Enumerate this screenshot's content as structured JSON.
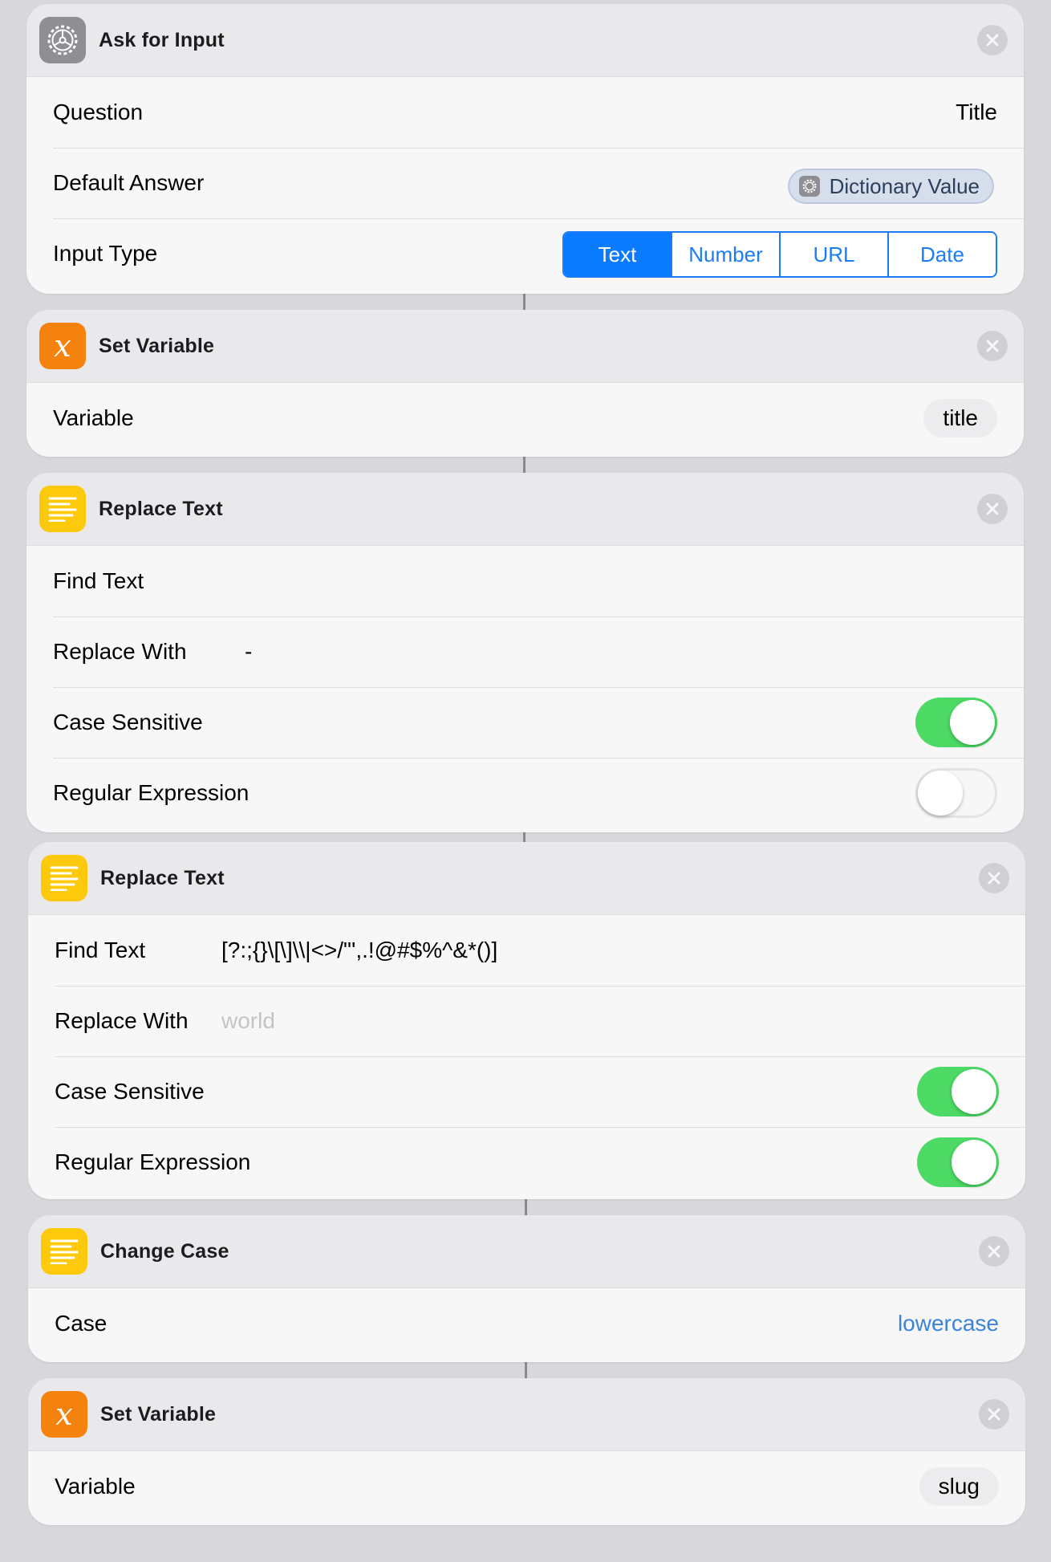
{
  "actions": [
    {
      "title": "Ask for Input",
      "icon": "gear-icon",
      "rows": {
        "question": {
          "label": "Question",
          "value": "Title"
        },
        "default_answer": {
          "label": "Default Answer",
          "token": "Dictionary Value"
        },
        "input_type": {
          "label": "Input Type",
          "options": [
            "Text",
            "Number",
            "URL",
            "Date"
          ],
          "selected": "Text"
        }
      }
    },
    {
      "title": "Set Variable",
      "icon": "variable-icon",
      "rows": {
        "variable": {
          "label": "Variable",
          "value": "title"
        }
      }
    },
    {
      "title": "Replace Text",
      "icon": "text-icon",
      "rows": {
        "find_text": {
          "label": "Find Text",
          "value": ""
        },
        "replace_with": {
          "label": "Replace With",
          "value": "-"
        },
        "case_sensitive": {
          "label": "Case Sensitive",
          "on": true
        },
        "regular_expression": {
          "label": "Regular Expression",
          "on": false
        }
      }
    },
    {
      "title": "Replace Text",
      "icon": "text-icon",
      "rows": {
        "find_text": {
          "label": "Find Text",
          "value": "[?:;{}\\[\\]\\\\|<>/\"',.!@#$%^&*()]"
        },
        "replace_with": {
          "label": "Replace With",
          "placeholder": "world"
        },
        "case_sensitive": {
          "label": "Case Sensitive",
          "on": true
        },
        "regular_expression": {
          "label": "Regular Expression",
          "on": true
        }
      }
    },
    {
      "title": "Change Case",
      "icon": "text-icon",
      "rows": {
        "case": {
          "label": "Case",
          "value": "lowercase"
        }
      }
    },
    {
      "title": "Set Variable",
      "icon": "variable-icon",
      "rows": {
        "variable": {
          "label": "Variable",
          "value": "slug"
        }
      }
    }
  ],
  "colors": {
    "accent_blue": "#0a7aff",
    "toggle_on": "#4cd964",
    "variable_orange": "#f5820d",
    "text_yellow": "#fdc90d",
    "gear_gray": "#8e8e93"
  }
}
